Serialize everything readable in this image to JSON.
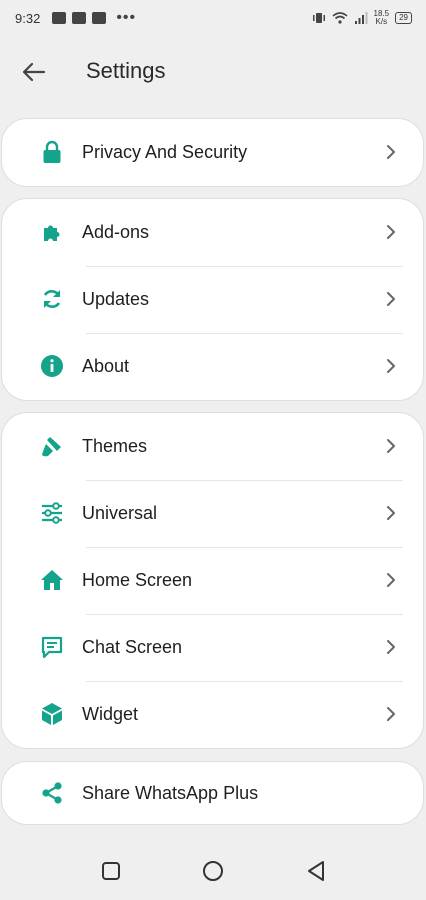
{
  "status_bar": {
    "time": "9:32",
    "speed_value": "18.5",
    "speed_unit": "K/s",
    "battery": "29"
  },
  "header": {
    "title": "Settings"
  },
  "colors": {
    "accent": "#14a38b",
    "background": "#efefef",
    "card": "#ffffff"
  },
  "groups": [
    {
      "items": [
        {
          "label": "Privacy And Security",
          "icon": "lock-icon"
        }
      ]
    },
    {
      "items": [
        {
          "label": "Add-ons",
          "icon": "puzzle-icon"
        },
        {
          "label": "Updates",
          "icon": "refresh-icon"
        },
        {
          "label": "About",
          "icon": "info-icon"
        }
      ]
    },
    {
      "items": [
        {
          "label": "Themes",
          "icon": "brush-icon"
        },
        {
          "label": "Universal",
          "icon": "sliders-icon"
        },
        {
          "label": "Home Screen",
          "icon": "home-icon"
        },
        {
          "label": "Chat Screen",
          "icon": "chat-icon"
        },
        {
          "label": "Widget",
          "icon": "cube-icon"
        }
      ]
    },
    {
      "items": [
        {
          "label": "Share WhatsApp Plus",
          "icon": "share-icon"
        }
      ]
    }
  ]
}
